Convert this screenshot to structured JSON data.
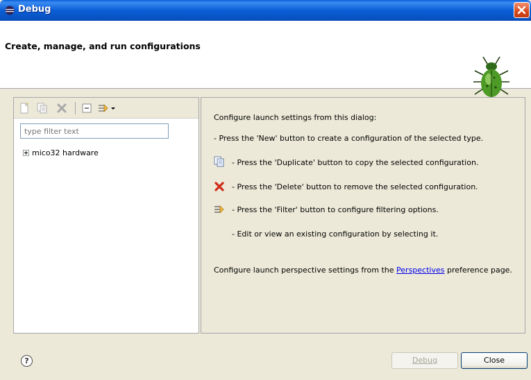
{
  "window": {
    "title": "Debug"
  },
  "header": {
    "title": "Create, manage, and run configurations"
  },
  "left_panel": {
    "filter_placeholder": "type filter text",
    "tree": [
      {
        "label": "mico32 hardware",
        "expanded": false
      }
    ],
    "toolbar_icons": [
      "new-config-icon",
      "duplicate-icon",
      "delete-icon",
      "collapse-all-icon",
      "filter-icon",
      "dropdown-arrow-icon"
    ]
  },
  "right_panel": {
    "intro": "Configure launch settings from this dialog:",
    "new_line": "- Press the 'New' button to create a configuration of the selected type.",
    "duplicate_line": "- Press the 'Duplicate' button to copy the selected configuration.",
    "delete_line": "- Press the 'Delete' button to remove the selected configuration.",
    "filter_line": "- Press the 'Filter' button to configure filtering options.",
    "edit_line": "- Edit or view an existing configuration by selecting it.",
    "perspective_before": "Configure launch perspective settings from the ",
    "perspective_link": "Perspectives",
    "perspective_after": " preference page."
  },
  "footer": {
    "help_glyph": "?",
    "debug_label": "Debug",
    "close_label": "Close"
  },
  "colors": {
    "titlebar": "#0a5fd8",
    "close": "#d94a1c",
    "dialog_bg": "#ece9d8",
    "link": "#0000ee"
  }
}
